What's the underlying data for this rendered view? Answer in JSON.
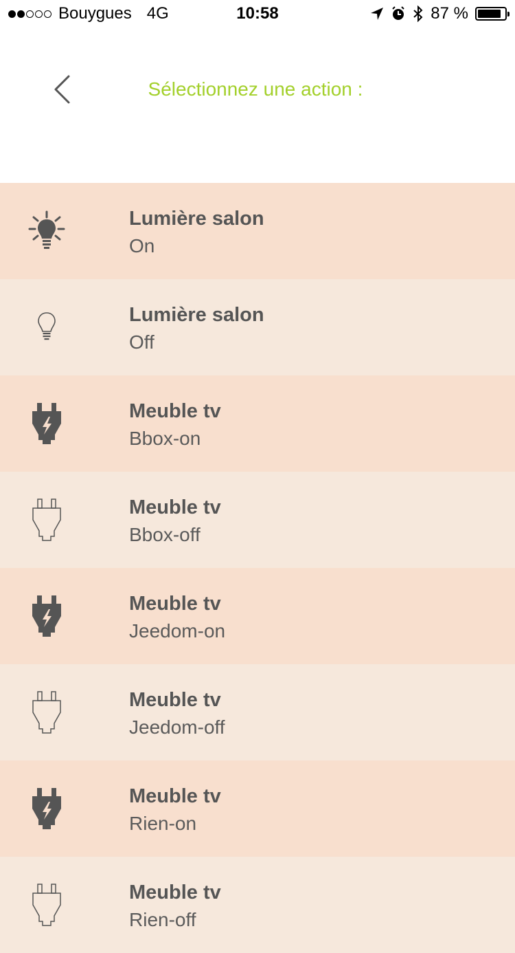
{
  "status_bar": {
    "carrier": "Bouygues",
    "network": "4G",
    "time": "10:58",
    "battery": "87 %",
    "battery_level": 0.87,
    "signal_strength": 2
  },
  "header": {
    "title": "Sélectionnez une action :",
    "back_icon": "chevron-left-icon",
    "accent_color": "#a3d02b"
  },
  "actions": [
    {
      "name": "Lumière salon",
      "state": "On",
      "icon": "bulb-on-icon",
      "active": true
    },
    {
      "name": "Lumière salon",
      "state": "Off",
      "icon": "bulb-off-icon",
      "active": false
    },
    {
      "name": "Meuble tv",
      "state": "Bbox-on",
      "icon": "plug-on-icon",
      "active": true
    },
    {
      "name": "Meuble tv",
      "state": "Bbox-off",
      "icon": "plug-off-icon",
      "active": false
    },
    {
      "name": "Meuble tv",
      "state": "Jeedom-on",
      "icon": "plug-on-icon",
      "active": true
    },
    {
      "name": "Meuble tv",
      "state": "Jeedom-off",
      "icon": "plug-off-icon",
      "active": false
    },
    {
      "name": "Meuble tv",
      "state": "Rien-on",
      "icon": "plug-on-icon",
      "active": true
    },
    {
      "name": "Meuble tv",
      "state": "Rien-off",
      "icon": "plug-off-icon",
      "active": false
    }
  ],
  "colors": {
    "row_on": "#f8dfce",
    "row_off": "#f6e8dc",
    "text": "#555555"
  }
}
